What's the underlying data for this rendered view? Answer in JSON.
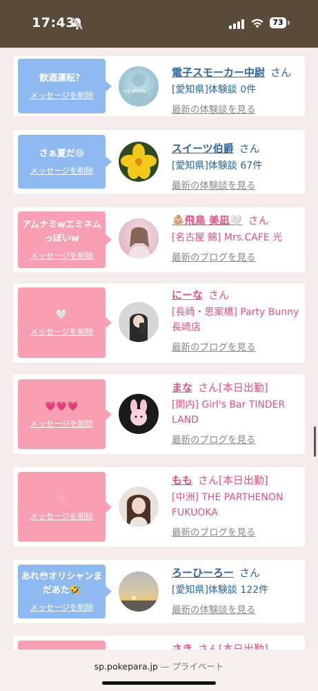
{
  "status_bar": {
    "time": "17:43",
    "battery": "73"
  },
  "cards": [
    {
      "bubble_color": "blue",
      "message": "飲酒運転？",
      "delete_label": "メッセージを削除",
      "name": "電子スモーカー中尉",
      "san": "さん",
      "badge": "",
      "area": "[愛知県]体験談 0件",
      "latest": "最新の体験談を見る",
      "text_color": "blue",
      "avatar": "no-photo"
    },
    {
      "bubble_color": "blue",
      "message": "さぁ夏だ😆",
      "delete_label": "メッセージを削除",
      "name": "スイーツ伯爵",
      "san": "さん",
      "badge": "",
      "area": "[愛知県]体験談 67件",
      "latest": "最新の体験談を見る",
      "text_color": "blue",
      "avatar": "yellow-flower"
    },
    {
      "bubble_color": "pink",
      "message": "アムナミwエミネムっぽいw",
      "delete_label": "メッセージを削除",
      "name": "👶🏼飛鳥 美凪🤍",
      "san": "さん",
      "badge": "",
      "area": "[名古屋 錦] Mrs.CAFE 光",
      "latest": "最新のブログを見る",
      "text_color": "pink",
      "avatar": "pink-photo"
    },
    {
      "bubble_color": "pink",
      "message": "🤍",
      "delete_label": "メッセージを削除",
      "name": "にーな",
      "san": "さん",
      "badge": "",
      "area": "[長崎・思案橋] Party Bunny 長崎店",
      "latest": "最新のブログを見る",
      "text_color": "pink",
      "avatar": "selfie"
    },
    {
      "bubble_color": "pink",
      "message": "💗💗💗",
      "delete_label": "メッセージを削除",
      "name": "まな",
      "san": "さん",
      "badge": "[本日出勤]",
      "area": "[関内] Girl's Bar TINDER LAND",
      "latest": "最新のブログを見る",
      "text_color": "pink",
      "avatar": "bunny-plush"
    },
    {
      "bubble_color": "pink",
      "message": "♡",
      "delete_label": "メッセージを削除",
      "name": "もも",
      "san": "さん",
      "badge": "[本日出勤]",
      "area": "[中洲] THE PARTHENON FUKUOKA",
      "latest": "最新のブログを見る",
      "text_color": "pink",
      "avatar": "portrait"
    },
    {
      "bubble_color": "blue",
      "message": "あれ😳オリシャンまだあた🤣",
      "delete_label": "メッセージを削除",
      "name": "ろーひーろー",
      "san": "さん",
      "badge": "",
      "area": "[愛知県]体験談 122件",
      "latest": "最新の体験談を見る",
      "text_color": "blue",
      "avatar": "sunset"
    },
    {
      "bubble_color": "pink",
      "message": "",
      "delete_label": "",
      "name": "さき",
      "san": "さん",
      "badge": "[本日出勤]",
      "area": "",
      "latest": "",
      "text_color": "pink",
      "avatar": "partial"
    }
  ],
  "url_bar": {
    "domain": "sp.pokepara.jp",
    "separator": " — ",
    "mode": "プライベート"
  },
  "colors": {
    "header": "#5a4a3a",
    "blue_bubble": "#8fb9f1",
    "pink_bubble": "#f99fb4",
    "blue_text": "#2864a3",
    "pink_text": "#e0527e"
  }
}
